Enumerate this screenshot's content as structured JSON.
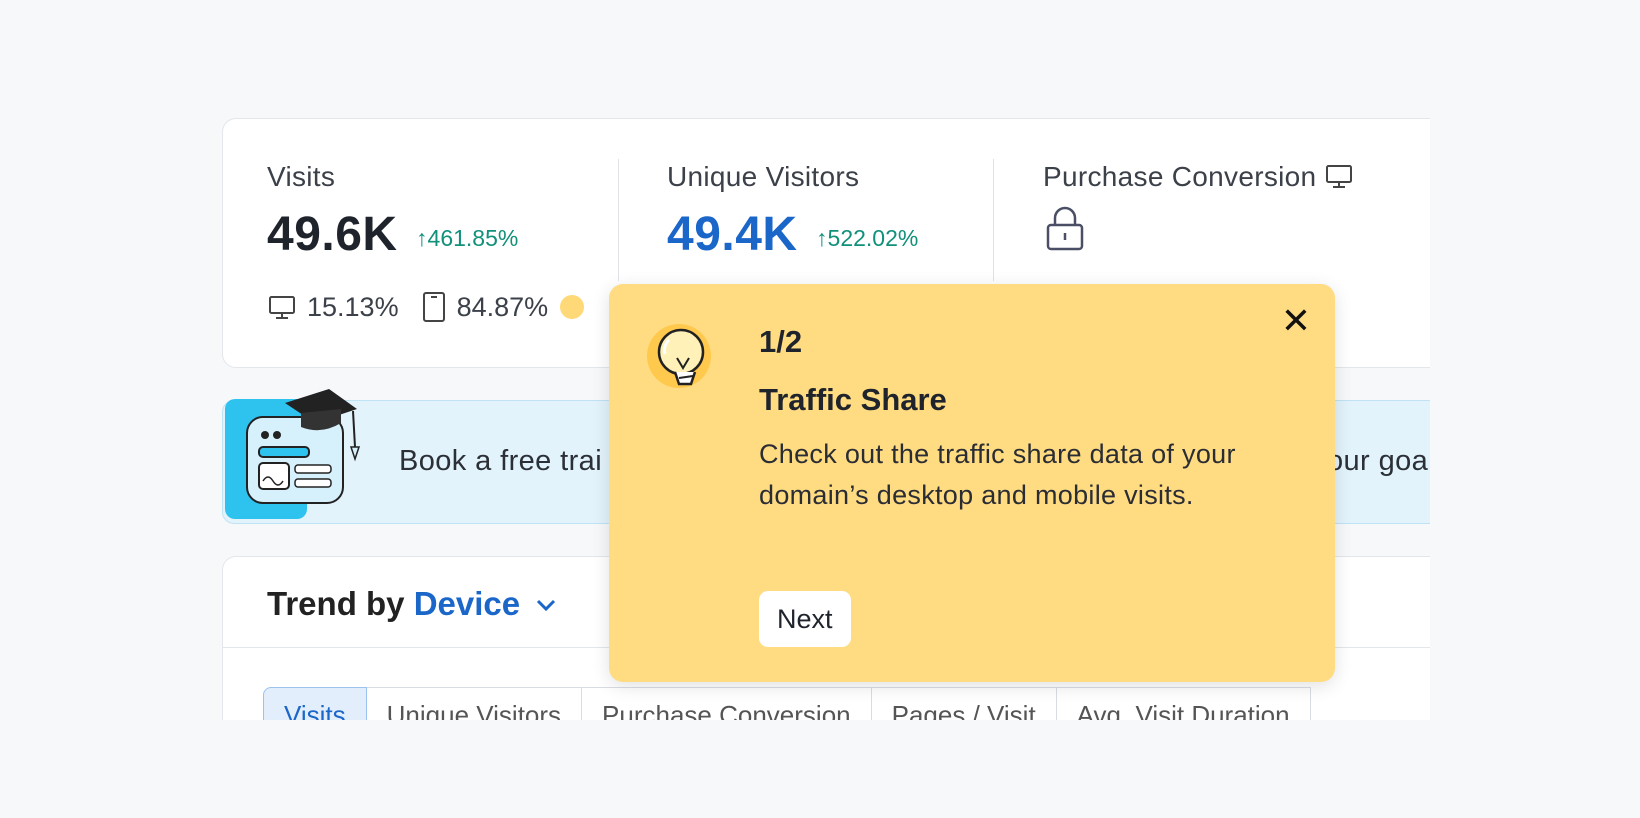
{
  "metrics": {
    "visits": {
      "label": "Visits",
      "value": "49.6K",
      "change": "↑461.85%"
    },
    "unique_visitors": {
      "label": "Unique Visitors",
      "value": "49.4K",
      "change": "↑522.02%"
    },
    "purchase_conversion": {
      "label": "Purchase Conversion"
    },
    "device_share": {
      "desktop": "15.13%",
      "mobile": "84.87%"
    }
  },
  "banner": {
    "text": "Book a free trai",
    "text_right": "our goa"
  },
  "trend": {
    "title_prefix": "Trend by",
    "title_link": "Device",
    "tabs": [
      "Visits",
      "Unique Visitors",
      "Purchase Conversion",
      "Pages / Visit",
      "Avg. Visit Duration"
    ]
  },
  "popover": {
    "step": "1/2",
    "title": "Traffic Share",
    "body": "Check out the traffic share data of your domain’s desktop and mobile visits.",
    "next_label": "Next",
    "close_icon": "close-icon"
  },
  "colors": {
    "accent_blue": "#1b66c9",
    "positive_green": "#11907a",
    "popover_bg": "#ffdb82",
    "banner_bg": "#e3f3fb"
  }
}
